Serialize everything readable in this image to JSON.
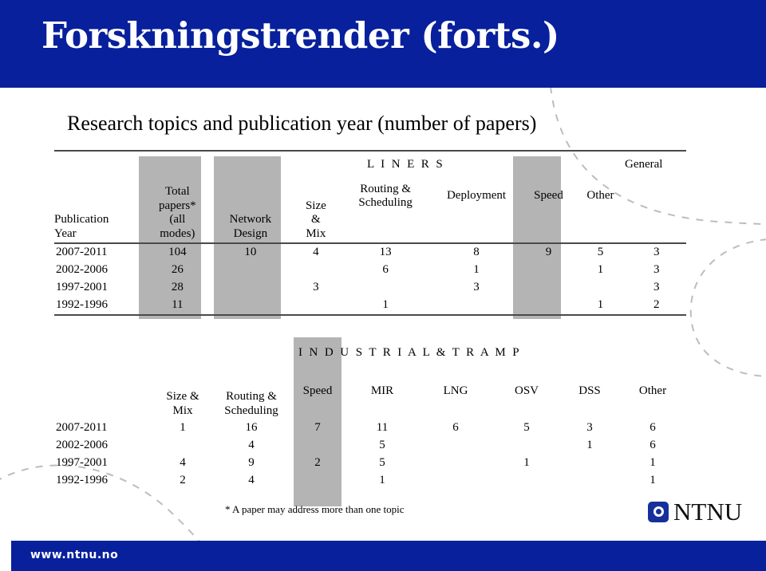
{
  "slide": {
    "title": "Forskningstrender (forts.)",
    "subtitle": "Research topics and publication year (number of papers)",
    "footnote": "* A paper may address more than one topic",
    "accent_color": "#08209c",
    "band_color": "#b4b4b4"
  },
  "table1": {
    "group_liners": "L I N E R S",
    "group_general": "General",
    "headers": {
      "year": "Publication Year",
      "total": "Total papers* (all modes)",
      "network_design": "Network Design",
      "size_mix": "Size & Mix",
      "routing_scheduling": "Routing & Scheduling",
      "deployment": "Deployment",
      "speed": "Speed",
      "other": "Other"
    },
    "header_lines": {
      "year_1": "Publication",
      "year_2": "Year",
      "total_1": "Total",
      "total_2": "papers*",
      "total_3": "(all",
      "total_4": "modes)",
      "nd_1": "Network",
      "nd_2": "Design",
      "sm_1": "Size",
      "sm_2": "&",
      "sm_3": "Mix",
      "rs_1": "Routing &",
      "rs_2": "Scheduling",
      "dep_1": "Deployment",
      "spd_1": "Speed",
      "oth_1": "Other"
    },
    "rows": [
      {
        "year": "2007-2011",
        "total": "104",
        "network_design": "10",
        "size_mix": "4",
        "routing_scheduling": "13",
        "deployment": "8",
        "speed": "9",
        "other": "5",
        "general": "3"
      },
      {
        "year": "2002-2006",
        "total": "26",
        "network_design": "",
        "size_mix": "",
        "routing_scheduling": "6",
        "deployment": "1",
        "speed": "",
        "other": "1",
        "general": "3"
      },
      {
        "year": "1997-2001",
        "total": "28",
        "network_design": "",
        "size_mix": "3",
        "routing_scheduling": "",
        "deployment": "3",
        "speed": "",
        "other": "",
        "general": "3"
      },
      {
        "year": "1992-1996",
        "total": "11",
        "network_design": "",
        "size_mix": "",
        "routing_scheduling": "1",
        "deployment": "",
        "speed": "",
        "other": "1",
        "general": "2"
      }
    ]
  },
  "table2": {
    "group_label": "I N D U S T R I A L  &  T R A M P",
    "header_lines": {
      "sm_1": "Size &",
      "sm_2": "Mix",
      "rs_1": "Routing &",
      "rs_2": "Scheduling",
      "spd_1": "Speed",
      "mir_1": "MIR",
      "lng_1": "LNG",
      "osv_1": "OSV",
      "dss_1": "DSS",
      "oth_1": "Other"
    },
    "rows": [
      {
        "year": "2007-2011",
        "size_mix": "1",
        "routing_scheduling": "16",
        "speed": "7",
        "mir": "11",
        "lng": "6",
        "osv": "5",
        "dss": "3",
        "other": "6"
      },
      {
        "year": "2002-2006",
        "size_mix": "",
        "routing_scheduling": "4",
        "speed": "",
        "mir": "5",
        "lng": "",
        "osv": "",
        "dss": "1",
        "other": "6"
      },
      {
        "year": "1997-2001",
        "size_mix": "4",
        "routing_scheduling": "9",
        "speed": "2",
        "mir": "5",
        "lng": "",
        "osv": "1",
        "dss": "",
        "other": "1"
      },
      {
        "year": "1992-1996",
        "size_mix": "2",
        "routing_scheduling": "4",
        "speed": "",
        "mir": "1",
        "lng": "",
        "osv": "",
        "dss": "",
        "other": "1"
      }
    ]
  },
  "branding": {
    "logo_text": "NTNU",
    "url": "www.ntnu.no"
  }
}
